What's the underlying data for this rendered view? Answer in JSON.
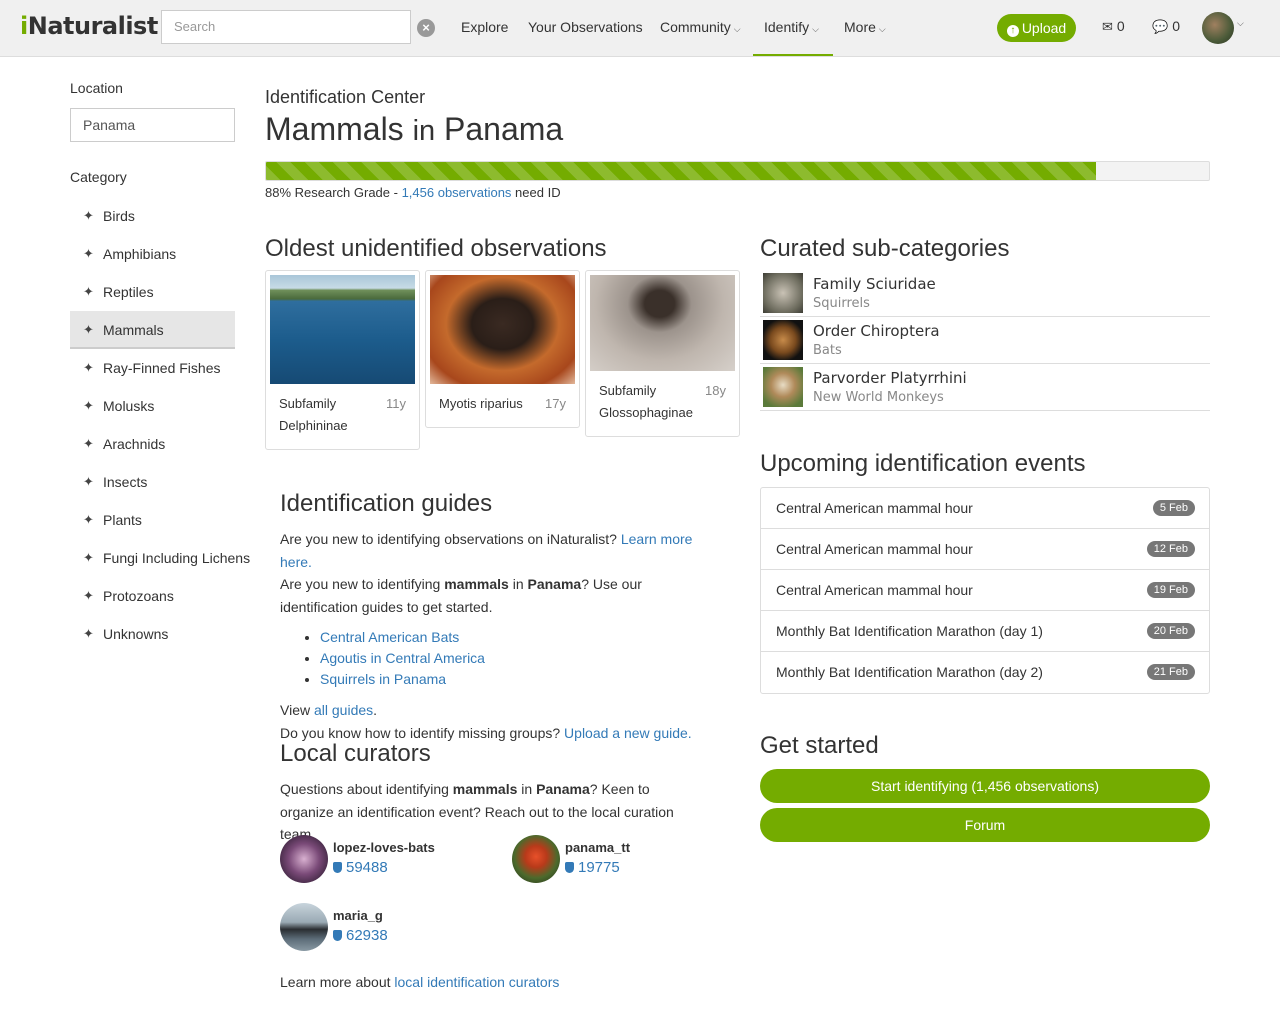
{
  "header": {
    "logo": "iNaturalist",
    "search_placeholder": "Search",
    "nav": [
      "Explore",
      "Your Observations",
      "Community",
      "Identify",
      "More"
    ],
    "upload_label": "Upload",
    "messages_count": "0",
    "notifications_count": "0"
  },
  "sidebar": {
    "location_label": "Location",
    "location_value": "Panama",
    "category_label": "Category",
    "categories": [
      {
        "label": "Birds",
        "icon": "bird-icon"
      },
      {
        "label": "Amphibians",
        "icon": "frog-icon"
      },
      {
        "label": "Reptiles",
        "icon": "lizard-icon"
      },
      {
        "label": "Mammals",
        "icon": "mammal-icon",
        "active": true
      },
      {
        "label": "Ray-Finned Fishes",
        "icon": "fish-icon"
      },
      {
        "label": "Molusks",
        "icon": "snail-icon"
      },
      {
        "label": "Arachnids",
        "icon": "spider-icon"
      },
      {
        "label": "Insects",
        "icon": "insect-icon"
      },
      {
        "label": "Plants",
        "icon": "plant-icon"
      },
      {
        "label": "Fungi Including Lichens",
        "icon": "mushroom-icon"
      },
      {
        "label": "Protozoans",
        "icon": "protozoa-icon"
      },
      {
        "label": "Unknowns",
        "icon": "unknown-icon"
      }
    ]
  },
  "main": {
    "kicker": "Identification Center",
    "title_taxon": "Mammals",
    "title_in": "in",
    "title_place": "Panama",
    "progress_fraction": 0.88,
    "progress_pct_text": "88% Research Grade - ",
    "progress_link": "1,456 observations",
    "progress_suffix": " need ID"
  },
  "oldest": {
    "heading": "Oldest unidentified observations",
    "items": [
      {
        "name": "Subfamily Delphininae",
        "age": "11y"
      },
      {
        "name": "Myotis riparius",
        "age": "17y"
      },
      {
        "name": "Subfamily Glossophaginae",
        "age": "18y"
      }
    ]
  },
  "curated": {
    "heading": "Curated sub-categories",
    "items": [
      {
        "name": "Family Sciuridae",
        "common": "Squirrels"
      },
      {
        "name": "Order Chiroptera",
        "common": "Bats"
      },
      {
        "name": "Parvorder Platyrrhini",
        "common": "New World Monkeys"
      }
    ]
  },
  "events": {
    "heading": "Upcoming identification events",
    "items": [
      {
        "name": "Central American mammal hour",
        "date": "5 Feb"
      },
      {
        "name": "Central American mammal hour",
        "date": "12 Feb"
      },
      {
        "name": "Central American mammal hour",
        "date": "19 Feb"
      },
      {
        "name": "Monthly Bat Identification Marathon (day 1)",
        "date": "20 Feb"
      },
      {
        "name": "Monthly Bat Identification Marathon (day 2)",
        "date": "21 Feb"
      }
    ]
  },
  "get_started": {
    "heading": "Get started",
    "start_label": "Start identifying (1,456 observations)",
    "forum_label": "Forum"
  },
  "guides": {
    "heading": "Identification guides",
    "line1_text": "Are you new to identifying observations on iNaturalist? ",
    "line1_link": "Learn more here.",
    "line2_a": "Are you new to identifying ",
    "line2_taxon": "mammals",
    "line2_b": " in ",
    "line2_place": "Panama",
    "line2_c": "? Use our identification guides to get started.",
    "links": [
      "Central American Bats",
      "Agoutis in Central America",
      "Squirrels in Panama"
    ],
    "view_text": "View ",
    "view_link": "all guides",
    "view_end": ".",
    "missing_text": "Do you know how to identify missing groups? ",
    "missing_link": "Upload a new guide."
  },
  "curators": {
    "heading": "Local curators",
    "intro_a": "Questions about identifying ",
    "intro_taxon": "mammals",
    "intro_b": " in ",
    "intro_place": "Panama",
    "intro_c": "? Keen to organize an identification event? Reach out to the local curation team.",
    "people": [
      {
        "login": "lopez-loves-bats",
        "count": "59488"
      },
      {
        "login": "panama_tt",
        "count": "19775"
      },
      {
        "login": "maria_g",
        "count": "62938"
      }
    ],
    "footer_text": "Learn more about ",
    "footer_link": "local identification curators"
  },
  "colors": {
    "brand": "#74ac00",
    "link": "#337ab7",
    "badge": "#777777"
  }
}
